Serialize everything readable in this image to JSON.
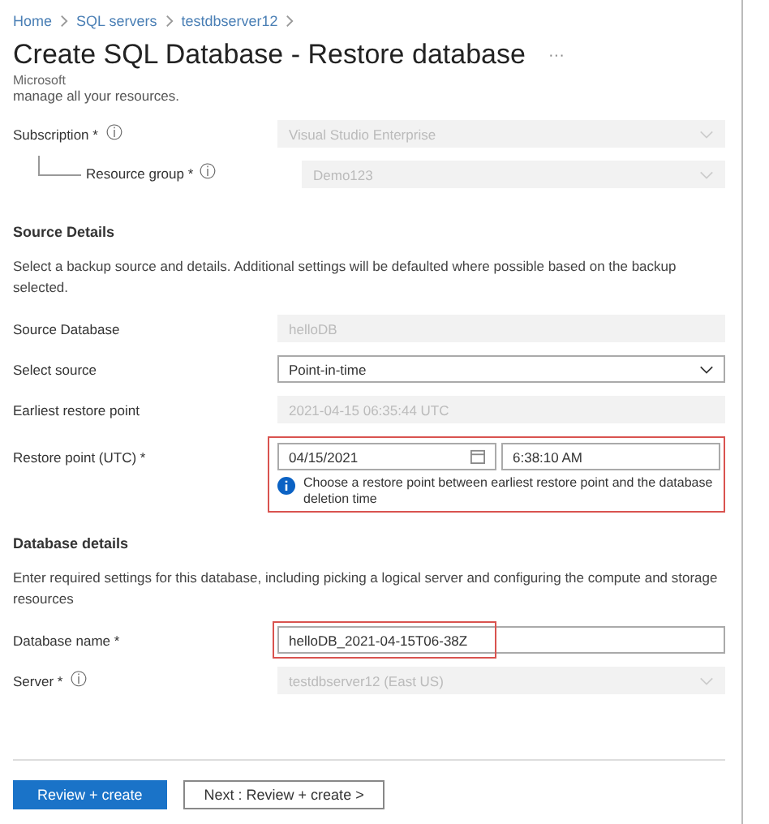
{
  "breadcrumb": [
    "Home",
    "SQL servers",
    "testdbserver12"
  ],
  "title": "Create SQL Database - Restore database",
  "more": "···",
  "publisher": "Microsoft",
  "intro_cut": "manage all your resources.",
  "project_fields": [
    {
      "label": "Subscription *",
      "info_icon": "ⓘ",
      "kind": "select",
      "disabled": true,
      "value": "Visual Studio Enterprise",
      "children": [
        {
          "label": "Resource group *",
          "info_icon": "ⓘ",
          "kind": "select",
          "disabled": true,
          "value": "Demo123"
        }
      ]
    }
  ],
  "sections": [
    {
      "heading": "Source Details",
      "description": "Select a backup source and details. Additional settings will be defaulted where possible based on the backup selected.",
      "fields": [
        {
          "label": "Source Database",
          "kind": "text",
          "disabled": true,
          "highlighted": false,
          "value": "helloDB"
        },
        {
          "label": "Select source",
          "kind": "select",
          "disabled": false,
          "highlighted": false,
          "value": "Point-in-time"
        },
        {
          "label": "Earliest restore point",
          "kind": "text",
          "disabled": true,
          "highlighted": false,
          "value": "2021-04-15 06:35:44 UTC"
        },
        {
          "label": "Restore point (UTC) *",
          "kind": "datetime",
          "highlighted": true,
          "date": "04/15/2021",
          "time": "6:38:10 AM",
          "note": "Choose a restore point between earliest restore point and the database deletion time"
        }
      ]
    },
    {
      "heading": "Database details",
      "description": "Enter required settings for this database, including picking a logical server and configuring the compute and storage resources",
      "fields": [
        {
          "label": "Database name *",
          "kind": "text",
          "disabled": false,
          "highlighted": true,
          "value": "helloDB_2021-04-15T06-38Z"
        },
        {
          "label": "Server *",
          "info_icon": "ⓘ",
          "kind": "select",
          "disabled": true,
          "highlighted": false,
          "value": "testdbserver12 (East US)"
        }
      ]
    }
  ],
  "buttons": [
    {
      "label": "Review + create",
      "primary": true
    },
    {
      "label": "Next : Review + create >",
      "primary": false
    }
  ]
}
